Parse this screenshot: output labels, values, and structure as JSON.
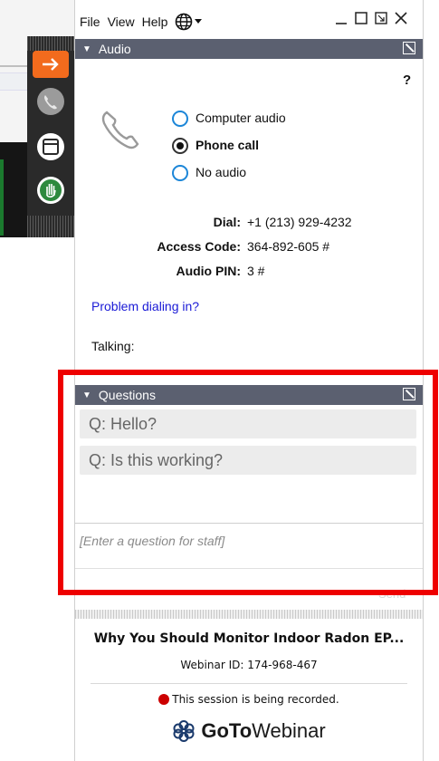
{
  "menu": {
    "file": "File",
    "view": "View",
    "help": "Help"
  },
  "audio": {
    "header": "Audio",
    "help_mark": "?",
    "options": [
      "Computer audio",
      "Phone call",
      "No audio"
    ],
    "selected": "Phone call",
    "dial_label": "Dial:",
    "dial_value": "+1 (213) 929-4232",
    "access_label": "Access Code:",
    "access_value": "364-892-605 #",
    "pin_label": "Audio PIN:",
    "pin_value": "3 #",
    "problem_link": "Problem dialing in?",
    "talking_label": "Talking:"
  },
  "questions": {
    "header": "Questions",
    "items": [
      "Q: Hello?",
      "Q: Is this working?"
    ],
    "input_placeholder": "[Enter a question for staff]",
    "send_label": "Send"
  },
  "footer": {
    "title": "Why You Should Monitor Indoor Radon EP...",
    "webinar_id": "Webinar ID: 174-968-467",
    "recording": "This session is being recorded.",
    "brand_go": "Go",
    "brand_to": "To",
    "brand_webinar": "Webinar"
  },
  "colors": {
    "header_bg": "#5b6070",
    "accent_orange": "#f26b1d",
    "link_blue": "#1a1ad6",
    "record_red": "#cc0000",
    "highlight_red": "#ee0000"
  }
}
